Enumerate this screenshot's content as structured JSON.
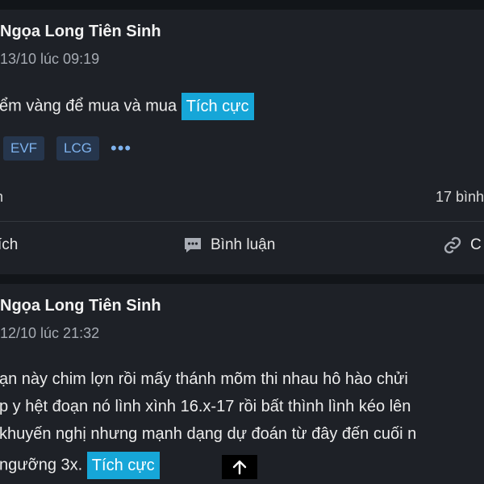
{
  "posts": [
    {
      "author": "Ngọa Long Tiên Sinh",
      "timestamp": "13/10 lúc 09:19",
      "body_lines": [
        "ểm vàng để mua và mua"
      ],
      "sentiment": "Tích cực",
      "tickers": [
        "EVF",
        "LCG"
      ],
      "more": "•••",
      "stat_left": "n",
      "stat_right": "17 bình",
      "actions": {
        "like": "ích",
        "comment": "Bình luận",
        "share": "C"
      }
    },
    {
      "author": "Ngọa Long Tiên Sinh",
      "timestamp": "12/10 lúc 21:32",
      "body_lines": [
        "ạn này chim lợn rồi mấy thánh mõm thi nhau hô hào chửi",
        "p y hệt đoạn nó lình xình 16.x-17 rồi bất thình lình kéo lên",
        "khuyến nghị nhưng mạnh dạng dự đoán từ đây đến cuối n",
        "ngưỡng 3x."
      ],
      "sentiment": "Tích cực"
    }
  ],
  "colors": {
    "background": "#121519",
    "card": "#1e2127",
    "sentiment_tag": "#16a6d8",
    "ticker_chip_bg": "#26364d",
    "ticker_chip_text": "#7fb3ee",
    "muted_text": "#a6abb3"
  },
  "icons": {
    "comment": "comment-bubble-icon",
    "share": "link-icon",
    "scroll_top": "arrow-up-icon",
    "more": "more-dots-icon"
  }
}
